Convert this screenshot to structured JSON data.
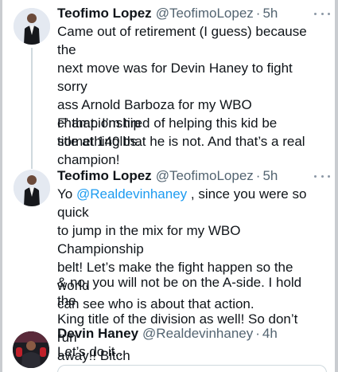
{
  "tweets": [
    {
      "name": "Teofimo Lopez",
      "handle": "@TeofimoLopez",
      "dot": "·",
      "time": "5h",
      "paragraphs": [
        "Came out of retirement (I guess) because the\nnext move was for Devin Haney to fight sorry\nass Arnold Barboza for my WBO championship\ntitle at 140lbs.",
        "F’ that. I’m tired of helping this kid be\nsomething that he is not. And that’s a real\nchampion!"
      ]
    },
    {
      "name": "Teofimo Lopez",
      "handle": "@TeofimoLopez",
      "dot": "·",
      "time": "5h",
      "text_prefix": "Yo ",
      "mention": "@Realdevinhaney",
      "text_rest": " , since you were so quick\nto jump in the mix for my WBO Championship\nbelt! Let’s make the fight happen so the world\ncan see who is about that action.",
      "paragraph2": "& no, you will not be on the A-side. I hold the\nKing title of the division as well! So don’t run\naway!! Bitch"
    },
    {
      "name": "Devin Haney",
      "handle": "@Realdevinhaney",
      "dot": "·",
      "time": "4h",
      "text": "Let’s do it.."
    }
  ],
  "icons": {
    "more": "more-horizontal-icon"
  }
}
